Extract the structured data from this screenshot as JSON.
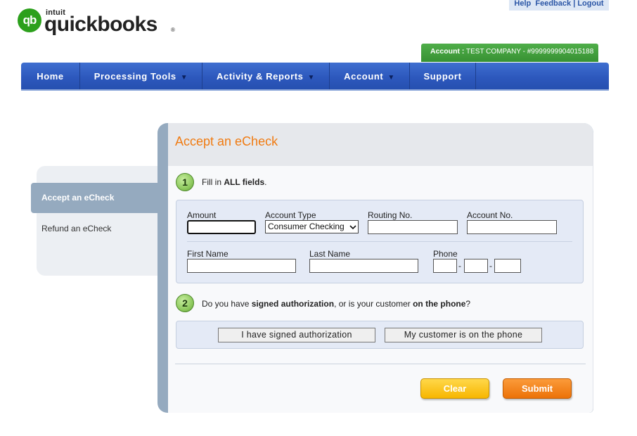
{
  "top_links": {
    "help": "Help",
    "feedback": "Feedback",
    "logout": "Logout",
    "sep": "|"
  },
  "logo": {
    "mark": "qb",
    "intuit": "intuit",
    "word": "quickbooks",
    "reg": "®"
  },
  "account_bar": {
    "label": "Account :",
    "value": "TEST COMPANY - #9999999904015188"
  },
  "nav": {
    "home": "Home",
    "processing_tools": "Processing Tools",
    "activity_reports": "Activity & Reports",
    "account": "Account",
    "support": "Support",
    "caret": "▼"
  },
  "sidebar": {
    "active": "Accept an eCheck",
    "refund": "Refund an eCheck"
  },
  "panel": {
    "title": "Accept an eCheck",
    "step1": {
      "num": "1",
      "pre": "Fill in ",
      "bold": "ALL fields",
      "post": "."
    },
    "fields": {
      "amount_label": "Amount",
      "amount_value": "",
      "account_type_label": "Account Type",
      "account_type_value": "Consumer Checking",
      "routing_label": "Routing No.",
      "routing_value": "",
      "account_no_label": "Account No.",
      "account_no_value": "",
      "first_name_label": "First Name",
      "first_name_value": "",
      "last_name_label": "Last Name",
      "last_name_value": "",
      "phone_label": "Phone",
      "phone_dash": "-"
    },
    "step2": {
      "num": "2",
      "t1": "Do you have ",
      "b1": "signed authorization",
      "t2": ", or is your customer ",
      "b2": "on the phone",
      "t3": "?"
    },
    "auth_buttons": {
      "signed": "I have signed authorization",
      "phone": "My customer is on the phone"
    },
    "actions": {
      "clear": "Clear",
      "submit": "Submit"
    }
  },
  "colors": {
    "brand_green": "#2ca01c",
    "nav_blue": "#2d58bd",
    "title_orange": "#f07b12",
    "clear_yellow": "#f7b600",
    "submit_orange": "#ec7208",
    "sidebar_slate": "#95aabf"
  }
}
